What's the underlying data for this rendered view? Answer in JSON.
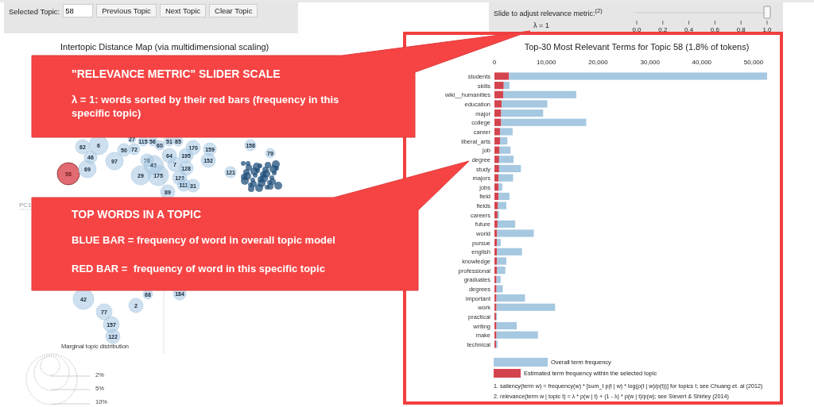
{
  "topic_controls": {
    "label": "Selected Topic:",
    "value": "58",
    "buttons": [
      "Previous Topic",
      "Next Topic",
      "Clear Topic"
    ]
  },
  "relevance_slider": {
    "label": "Slide to adjust relevance metric:$^{(2)}$",
    "lambda_label": "λ = 1",
    "level": 1,
    "ticks": [
      "0.0",
      "0.2",
      "0.4",
      "0.6",
      "0.8",
      "1.0"
    ]
  },
  "topic_map": {
    "title": "Intertopic Distance Map (via multidimensional scaling)",
    "axis_label": "PC1",
    "topics": [
      {
        "label": "27",
        "selected": false
      },
      {
        "label": "115",
        "selected": false
      },
      {
        "label": "56",
        "selected": false
      },
      {
        "label": "51",
        "selected": false
      },
      {
        "label": "85",
        "selected": false
      },
      {
        "label": "62",
        "selected": false
      },
      {
        "label": "6",
        "selected": false
      },
      {
        "label": "50",
        "selected": false
      },
      {
        "label": "72",
        "selected": false
      },
      {
        "label": "60",
        "selected": false
      },
      {
        "label": "170",
        "selected": false
      },
      {
        "label": "159",
        "selected": false
      },
      {
        "label": "158",
        "selected": false
      },
      {
        "label": "46",
        "selected": false
      },
      {
        "label": "97",
        "selected": false
      },
      {
        "label": "76",
        "selected": false
      },
      {
        "label": "64",
        "selected": false
      },
      {
        "label": "195",
        "selected": false
      },
      {
        "label": "152",
        "selected": false
      },
      {
        "label": "79",
        "selected": false
      },
      {
        "label": "58",
        "selected": true
      },
      {
        "label": "69",
        "selected": false
      },
      {
        "label": "29",
        "selected": false
      },
      {
        "label": "43",
        "selected": false
      },
      {
        "label": "175",
        "selected": false
      },
      {
        "label": "7",
        "selected": false
      },
      {
        "label": "123",
        "selected": false
      },
      {
        "label": "128",
        "selected": false
      },
      {
        "label": "121",
        "selected": false
      },
      {
        "label": "111",
        "selected": false
      },
      {
        "label": "31",
        "selected": false
      },
      {
        "label": "89",
        "selected": false
      },
      {
        "label": "42",
        "selected": false
      },
      {
        "label": "68",
        "selected": false
      },
      {
        "label": "184",
        "selected": false
      },
      {
        "label": "2",
        "selected": false
      },
      {
        "label": "77",
        "selected": false
      },
      {
        "label": "157",
        "selected": false
      },
      {
        "label": "122",
        "selected": false
      }
    ],
    "legend": {
      "title": "Marginal topic distribution",
      "sizes": [
        "2%",
        "5%",
        "10%"
      ]
    }
  },
  "term_chart": {
    "chart_data": {
      "type": "bar",
      "orientation": "horizontal",
      "stacked": true,
      "title": "Top-30 Most Relevant Terms for Topic 58 (1.8% of tokens)",
      "categories": [
        "students",
        "skills",
        "wiki__humanities",
        "education",
        "major",
        "college",
        "career",
        "liberal_arts",
        "job",
        "degree",
        "study",
        "majors",
        "jobs",
        "field",
        "fields",
        "careers",
        "future",
        "world",
        "pursue",
        "english",
        "knowledge",
        "professional",
        "graduates",
        "degrees",
        "important",
        "work",
        "practical",
        "writing",
        "make",
        "technical"
      ],
      "series": [
        {
          "name": "Estimated term frequency within the selected topic",
          "color": "#d4444f",
          "values": [
            2800,
            1800,
            1700,
            1400,
            1300,
            1300,
            1100,
            1100,
            1000,
            900,
            900,
            800,
            800,
            800,
            700,
            600,
            600,
            500,
            500,
            500,
            500,
            500,
            400,
            400,
            400,
            400,
            300,
            400,
            400,
            300
          ]
        },
        {
          "name": "Overall term frequency",
          "color": "#a6c8e1",
          "values": [
            49800,
            1100,
            14100,
            8800,
            8100,
            16400,
            2400,
            1400,
            2100,
            2800,
            4200,
            2800,
            700,
            2100,
            1600,
            300,
            3400,
            7100,
            700,
            4800,
            1800,
            1600,
            800,
            1200,
            5500,
            11300,
            200,
            3900,
            8000,
            300
          ]
        }
      ],
      "xlim": [
        0,
        52600
      ],
      "xticks": [
        {
          "value": 0,
          "label": "0"
        },
        {
          "value": 10000,
          "label": "10,000"
        },
        {
          "value": 20000,
          "label": "20,000"
        },
        {
          "value": 30000,
          "label": "30,000"
        },
        {
          "value": 40000,
          "label": "40,000"
        },
        {
          "value": 50000,
          "label": "50,000"
        }
      ]
    },
    "footnotes": [
      "1. saliency(term w) = frequency(w) * [sum_t p(t | w) * log(p(t | w)/p(t))] for topics t; see Chuang et. al (2012)",
      "2. relevance(term w | topic t) = λ * p(w | t) + (1 - λ) * p(w | t)/p(w); see Sievert & Shirley (2014)"
    ]
  },
  "callouts": [
    {
      "title": "\"RELEVANCE METRIC\" SLIDER SCALE",
      "lines": [
        "λ = 1: words sorted by their red bars (frequency in this specific topic)"
      ]
    },
    {
      "title": "TOP WORDS IN A TOPIC",
      "lines": [
        "BLUE BAR = frequency of word in overall topic model",
        "RED BAR =  frequency of word in this specific topic"
      ]
    }
  ]
}
